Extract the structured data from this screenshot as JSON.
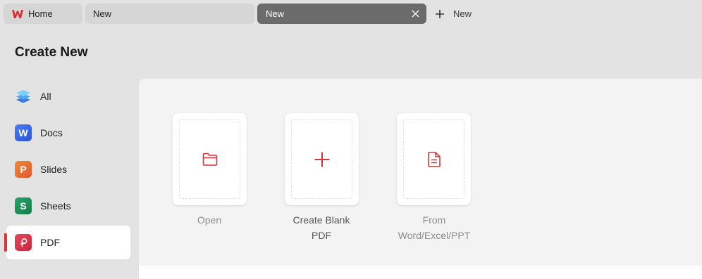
{
  "tabs": {
    "home_label": "Home",
    "tab2_label": "New",
    "tab3_label": "New",
    "new_tab_label": "New"
  },
  "page": {
    "title": "Create New"
  },
  "sidebar": {
    "items": [
      {
        "label": "All",
        "icon": "layers-icon"
      },
      {
        "label": "Docs",
        "icon": "wps-writer-icon",
        "glyph": "W"
      },
      {
        "label": "Slides",
        "icon": "wps-presentation-icon",
        "glyph": "P"
      },
      {
        "label": "Sheets",
        "icon": "wps-spreadsheet-icon",
        "glyph": "S"
      },
      {
        "label": "PDF",
        "icon": "wps-pdf-icon",
        "active": true
      }
    ]
  },
  "cards": [
    {
      "label": "Open",
      "icon": "folder-icon"
    },
    {
      "label_line1": "Create Blank",
      "label_line2": "PDF",
      "icon": "plus-icon"
    },
    {
      "label_line1": "From",
      "label_line2": "Word/Excel/PPT",
      "icon": "document-icon"
    }
  ],
  "colors": {
    "accent_red": "#d7343a",
    "active_tab_bg": "#6b6b6b",
    "window_bg": "#e3e3e3",
    "panel_bg": "#f3f3f3"
  }
}
